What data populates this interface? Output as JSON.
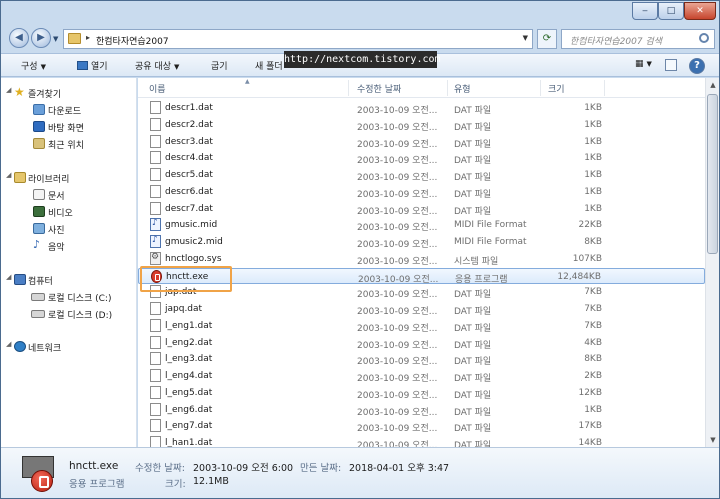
{
  "window": {
    "address_path": "한컴타자연습2007",
    "search_placeholder": "한컴타자연습2007 검색",
    "watermark": "http://nextcom.tistory.com"
  },
  "toolbar": {
    "organize": "구성",
    "open": "열기",
    "share": "공유 대상",
    "burn": "굽기",
    "new_folder": "새 폴더"
  },
  "nav": {
    "favorites": "즐겨찾기",
    "downloads": "다운로드",
    "desktop": "바탕 화면",
    "recent": "최근 위치",
    "libraries": "라이브러리",
    "documents": "문서",
    "videos": "비디오",
    "pictures": "사진",
    "music": "음악",
    "computer": "컴퓨터",
    "local_c": "로컬 디스크 (C:)",
    "local_d": "로컬 디스크 (D:)",
    "network": "네트워크"
  },
  "columns": {
    "name": "이름",
    "modified": "수정한 날짜",
    "type": "유형",
    "size": "크기"
  },
  "files": [
    {
      "name": "descr1.dat",
      "date": "2003-10-09 오전...",
      "type": "DAT 파일",
      "size": "1KB",
      "icon": "dat"
    },
    {
      "name": "descr2.dat",
      "date": "2003-10-09 오전...",
      "type": "DAT 파일",
      "size": "1KB",
      "icon": "dat"
    },
    {
      "name": "descr3.dat",
      "date": "2003-10-09 오전...",
      "type": "DAT 파일",
      "size": "1KB",
      "icon": "dat"
    },
    {
      "name": "descr4.dat",
      "date": "2003-10-09 오전...",
      "type": "DAT 파일",
      "size": "1KB",
      "icon": "dat"
    },
    {
      "name": "descr5.dat",
      "date": "2003-10-09 오전...",
      "type": "DAT 파일",
      "size": "1KB",
      "icon": "dat"
    },
    {
      "name": "descr6.dat",
      "date": "2003-10-09 오전...",
      "type": "DAT 파일",
      "size": "1KB",
      "icon": "dat"
    },
    {
      "name": "descr7.dat",
      "date": "2003-10-09 오전...",
      "type": "DAT 파일",
      "size": "1KB",
      "icon": "dat"
    },
    {
      "name": "gmusic.mid",
      "date": "2003-10-09 오전...",
      "type": "MIDI File Format",
      "size": "22KB",
      "icon": "mid"
    },
    {
      "name": "gmusic2.mid",
      "date": "2003-10-09 오전...",
      "type": "MIDI File Format",
      "size": "8KB",
      "icon": "mid"
    },
    {
      "name": "hnctlogo.sys",
      "date": "2003-10-09 오전...",
      "type": "시스템 파일",
      "size": "107KB",
      "icon": "sys"
    },
    {
      "name": "hnctt.exe",
      "date": "2003-10-09 오전...",
      "type": "응용 프로그램",
      "size": "12,484KB",
      "icon": "exe",
      "selected": true
    },
    {
      "name": "jap.dat",
      "date": "2003-10-09 오전...",
      "type": "DAT 파일",
      "size": "7KB",
      "icon": "dat"
    },
    {
      "name": "japq.dat",
      "date": "2003-10-09 오전...",
      "type": "DAT 파일",
      "size": "7KB",
      "icon": "dat"
    },
    {
      "name": "l_eng1.dat",
      "date": "2003-10-09 오전...",
      "type": "DAT 파일",
      "size": "7KB",
      "icon": "dat"
    },
    {
      "name": "l_eng2.dat",
      "date": "2003-10-09 오전...",
      "type": "DAT 파일",
      "size": "4KB",
      "icon": "dat"
    },
    {
      "name": "l_eng3.dat",
      "date": "2003-10-09 오전...",
      "type": "DAT 파일",
      "size": "8KB",
      "icon": "dat"
    },
    {
      "name": "l_eng4.dat",
      "date": "2003-10-09 오전...",
      "type": "DAT 파일",
      "size": "2KB",
      "icon": "dat"
    },
    {
      "name": "l_eng5.dat",
      "date": "2003-10-09 오전...",
      "type": "DAT 파일",
      "size": "12KB",
      "icon": "dat"
    },
    {
      "name": "l_eng6.dat",
      "date": "2003-10-09 오전...",
      "type": "DAT 파일",
      "size": "1KB",
      "icon": "dat"
    },
    {
      "name": "l_eng7.dat",
      "date": "2003-10-09 오전...",
      "type": "DAT 파일",
      "size": "17KB",
      "icon": "dat"
    },
    {
      "name": "l_han1.dat",
      "date": "2003-10-09 오전...",
      "type": "DAT 파일",
      "size": "14KB",
      "icon": "dat"
    }
  ],
  "details": {
    "filename": "hnctt.exe",
    "filetype": "응용 프로그램",
    "modified_label": "수정한 날짜:",
    "modified_value": "2003-10-09 오전 6:00",
    "created_label": "만든 날짜:",
    "created_value": "2018-04-01 오후 3:47",
    "size_label": "크기:",
    "size_value": "12.1MB"
  },
  "colors": {
    "highlight_box": "#f0a347",
    "selection": "#dcebfc",
    "chrome": "#c9dbee"
  }
}
